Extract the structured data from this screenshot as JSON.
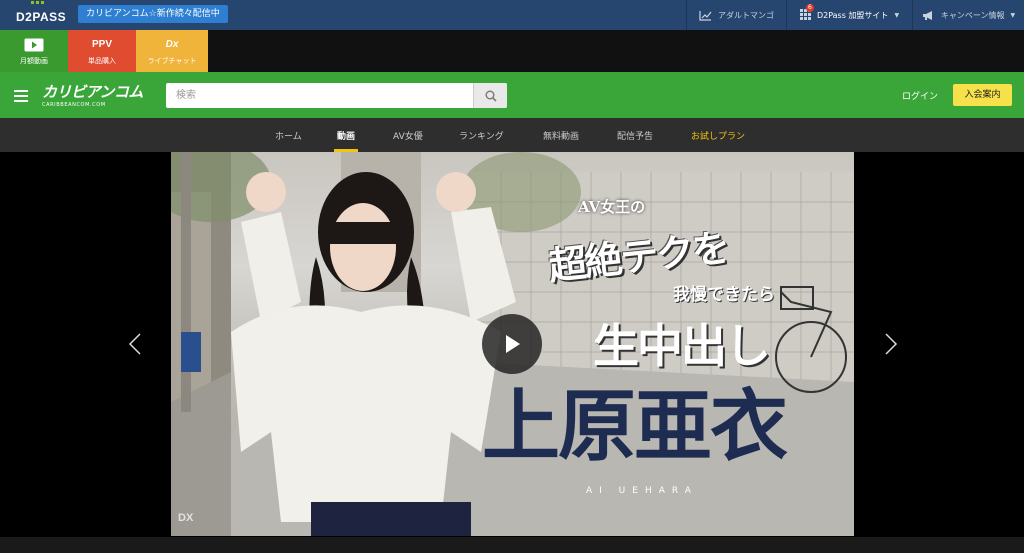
{
  "d2pass": {
    "logo": "D2PASS",
    "banner": "カリビアンコム☆新作続々配信中",
    "links": [
      {
        "label": "アダルトマンゴ",
        "icon": "chart-line-icon"
      },
      {
        "label": "D2Pass 加盟サイト",
        "icon": "grid-icon",
        "badge": "6"
      },
      {
        "label": "キャンペーン情報",
        "icon": "megaphone-icon"
      }
    ]
  },
  "services": [
    {
      "icon_text": "",
      "label": "月額動画",
      "icon": "play-box-icon",
      "color": "#3a9a2f"
    },
    {
      "icon_text": "PPV",
      "label": "単品購入",
      "color": "#e04c30"
    },
    {
      "icon_text": "Dx",
      "label": "ライブチャット",
      "color": "#f0b43a"
    }
  ],
  "header": {
    "brand": "カリビアンコム",
    "brand_sub": "CARIBBEANCOM.COM",
    "search_placeholder": "検索",
    "login": "ログイン",
    "join": "入会案内"
  },
  "nav": {
    "items": [
      "ホーム",
      "動画",
      "AV女優",
      "ランキング",
      "無料動画",
      "配信予告",
      "お試しプラン"
    ],
    "active": "動画"
  },
  "hero": {
    "line1": "AV女王の",
    "line2": "超絶テクを",
    "line3": "我慢できたら",
    "line4": "生中出し",
    "name": "上原亜衣",
    "name_roman": "AI UEHARA",
    "watermark": "DX"
  },
  "colors": {
    "topbar": "#27466f",
    "header_green": "#3aa63a",
    "accent_yellow": "#f2c40d"
  }
}
